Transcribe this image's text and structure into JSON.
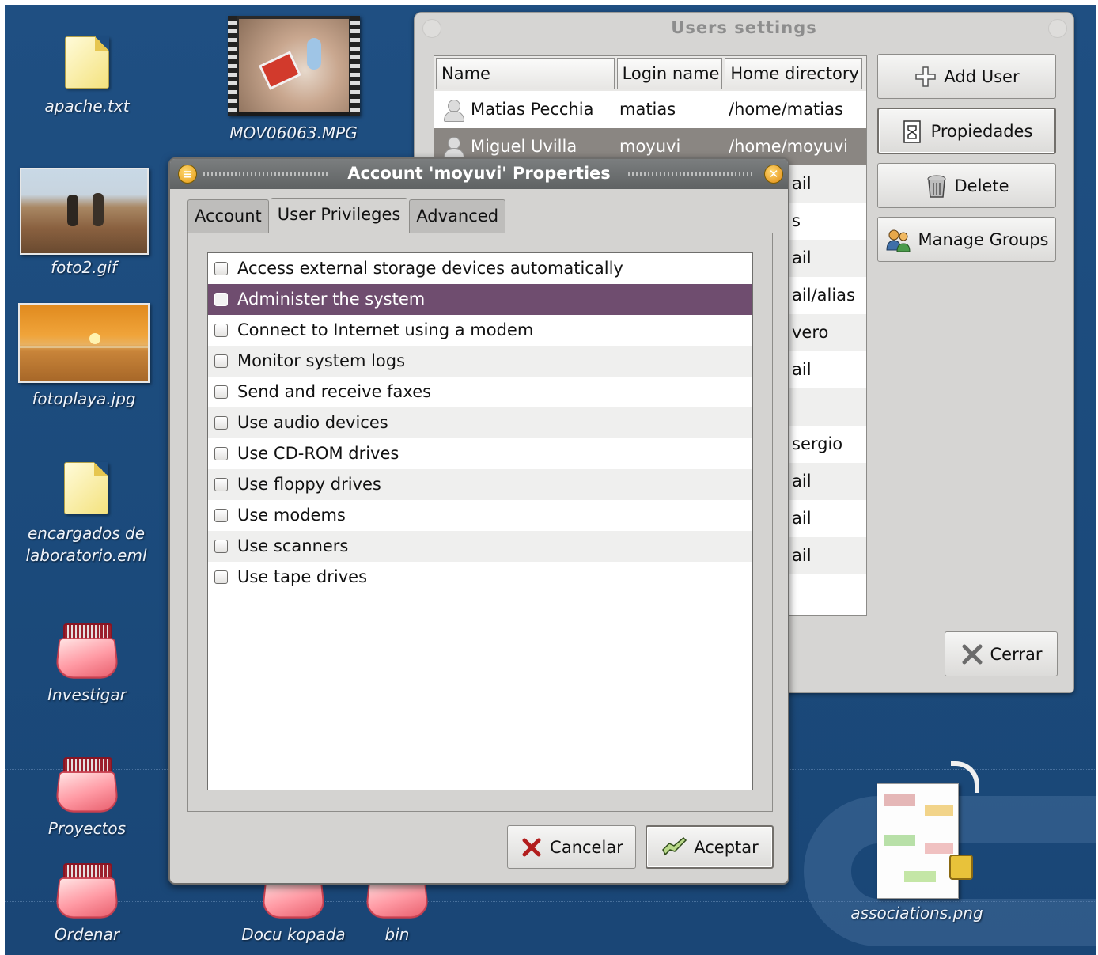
{
  "desktop": {
    "icons": [
      {
        "label": "apache.txt",
        "type": "text-file-icon"
      },
      {
        "label": "MOV06063.MPG",
        "type": "video-thumbnail"
      },
      {
        "label": "foto2.gif",
        "type": "image-thumbnail"
      },
      {
        "label": "fotoplaya.jpg",
        "type": "image-thumbnail"
      },
      {
        "label": "encargados de laboratorio.eml",
        "type": "text-file-icon"
      },
      {
        "label": "Investigar",
        "type": "folder-icon"
      },
      {
        "label": "Proyectos",
        "type": "folder-icon"
      },
      {
        "label": "Ordenar",
        "type": "folder-icon"
      },
      {
        "label": "Docu kopada",
        "type": "folder-icon"
      },
      {
        "label": "bin",
        "type": "folder-icon"
      },
      {
        "label": "associations.png",
        "type": "image-thumbnail"
      }
    ]
  },
  "users_window": {
    "title": "Users settings",
    "columns": [
      "Name",
      "Login name",
      "Home directory"
    ],
    "rows": [
      {
        "name": "Matias Pecchia",
        "login": "matias",
        "home": "/home/matias"
      },
      {
        "name": "Miguel Uvilla",
        "login": "moyuvi",
        "home": "/home/moyuvi"
      }
    ],
    "hidden_row_fragments": [
      "ail",
      "s",
      "ail",
      "ail/alias",
      "vero",
      "ail",
      "",
      "sergio",
      "ail",
      "ail",
      "ail"
    ],
    "buttons": {
      "add_user": "Add User",
      "properties": "Propiedades",
      "delete": "Delete",
      "manage_groups": "Manage Groups",
      "close": "Cerrar"
    }
  },
  "props_dialog": {
    "title": "Account 'moyuvi' Properties",
    "tabs": [
      "Account",
      "User Privileges",
      "Advanced"
    ],
    "active_tab": "User Privileges",
    "privileges": [
      "Access external storage devices automatically",
      "Administer the system",
      "Connect to Internet using a modem",
      "Monitor system logs",
      "Send and receive faxes",
      "Use audio devices",
      "Use CD-ROM drives",
      "Use floppy drives",
      "Use modems",
      "Use scanners",
      "Use tape drives"
    ],
    "selected_privilege": "Administer the system",
    "buttons": {
      "cancel": "Cancelar",
      "ok": "Aceptar"
    }
  }
}
